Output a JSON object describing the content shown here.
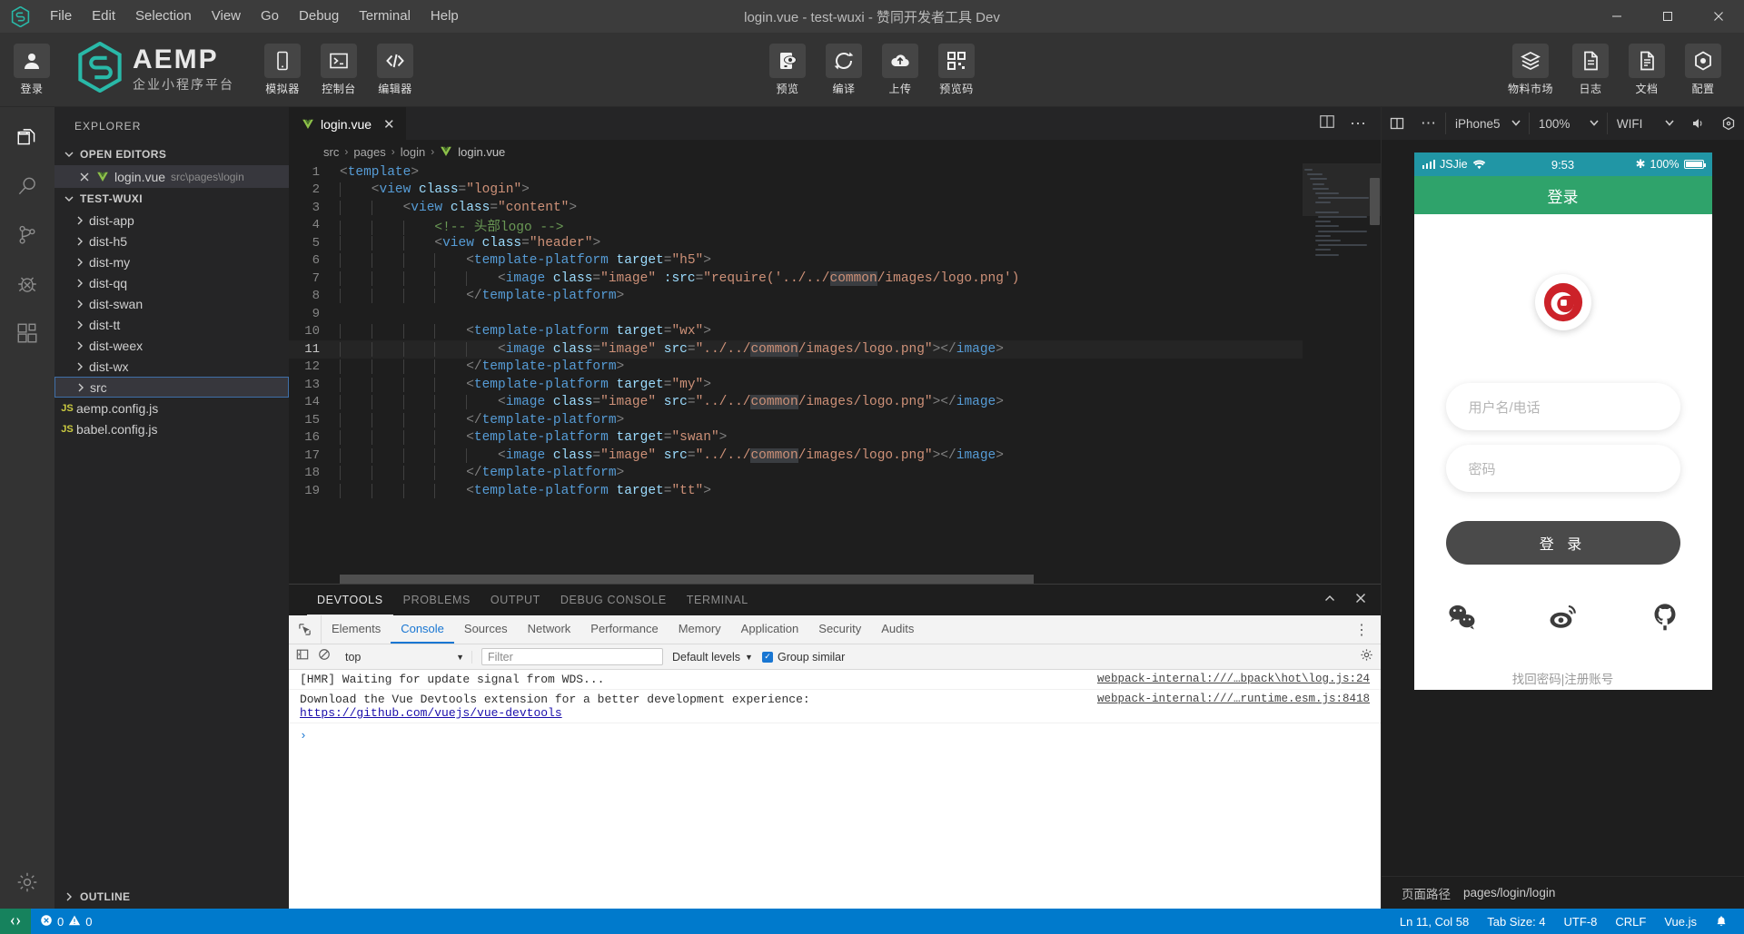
{
  "titlebar": {
    "app_icon": "aemp-hex-logo-icon",
    "menus": [
      "File",
      "Edit",
      "Selection",
      "View",
      "Go",
      "Debug",
      "Terminal",
      "Help"
    ],
    "title": "login.vue - test-wuxi - 赞同开发者工具 Dev",
    "window_buttons": [
      "minimize-icon",
      "maximize-icon",
      "close-icon"
    ]
  },
  "aemp_toolbar": {
    "login": {
      "label": "登录",
      "icon": "user-avatar-icon"
    },
    "brand": {
      "name": "AEMP",
      "sub": "企业小程序平台",
      "icon": "aemp-hex-logo-icon"
    },
    "left_tools": [
      {
        "label": "模拟器",
        "icon": "phone-icon"
      },
      {
        "label": "控制台",
        "icon": "terminal-icon"
      },
      {
        "label": "编辑器",
        "icon": "code-brackets-icon"
      }
    ],
    "center_tools": [
      {
        "label": "预览",
        "icon": "preview-eye-icon"
      },
      {
        "label": "编译",
        "icon": "refresh-circle-icon"
      },
      {
        "label": "上传",
        "icon": "cloud-upload-icon"
      },
      {
        "label": "预览码",
        "icon": "qrcode-icon"
      }
    ],
    "right_tools": [
      {
        "label": "物料市场",
        "icon": "layers-icon"
      },
      {
        "label": "日志",
        "icon": "document-icon"
      },
      {
        "label": "文档",
        "icon": "document-lines-icon"
      },
      {
        "label": "配置",
        "icon": "hex-gear-icon"
      }
    ]
  },
  "activitybar": {
    "items": [
      {
        "name": "explorer",
        "icon": "files-icon",
        "active": true
      },
      {
        "name": "search",
        "icon": "search-icon",
        "active": false
      },
      {
        "name": "source-control",
        "icon": "source-control-branch-icon",
        "active": false
      },
      {
        "name": "debug",
        "icon": "bug-icon",
        "active": false
      },
      {
        "name": "extensions",
        "icon": "extensions-blocks-icon",
        "active": false
      }
    ],
    "bottom": {
      "name": "manage",
      "icon": "gear-icon"
    }
  },
  "sidebar": {
    "title": "EXPLORER",
    "open_editors": {
      "label": "OPEN EDITORS",
      "items": [
        {
          "name": "login.vue",
          "path": "src\\pages\\login",
          "icon": "vue-file-icon",
          "close": "close-icon"
        }
      ]
    },
    "project": {
      "label": "TEST-WUXI",
      "folders": [
        "dist-app",
        "dist-h5",
        "dist-my",
        "dist-qq",
        "dist-swan",
        "dist-tt",
        "dist-weex",
        "dist-wx",
        "src"
      ],
      "selected_folder": "src",
      "files": [
        {
          "name": "aemp.config.js",
          "badge": "JS"
        },
        {
          "name": "babel.config.js",
          "badge": "JS"
        }
      ]
    },
    "outline_label": "OUTLINE"
  },
  "editor": {
    "tab": {
      "name": "login.vue",
      "icon": "vue-file-icon",
      "close": "close-icon"
    },
    "tab_actions": [
      "split-editor-icon",
      "more-actions-icon"
    ],
    "breadcrumb": [
      "src",
      "pages",
      "login",
      "login.vue"
    ],
    "lines": [
      {
        "n": 1,
        "indent": 0,
        "tokens": [
          [
            "t-punct",
            "<"
          ],
          [
            "t-tag",
            "template"
          ],
          [
            "t-punct",
            ">"
          ]
        ]
      },
      {
        "n": 2,
        "indent": 1,
        "tokens": [
          [
            "t-punct",
            "<"
          ],
          [
            "t-tag",
            "view"
          ],
          [
            "plain",
            " "
          ],
          [
            "t-attr",
            "class"
          ],
          [
            "t-punct",
            "="
          ],
          [
            "t-str",
            "\"login\""
          ],
          [
            "t-punct",
            ">"
          ]
        ]
      },
      {
        "n": 3,
        "indent": 2,
        "tokens": [
          [
            "t-punct",
            "<"
          ],
          [
            "t-tag",
            "view"
          ],
          [
            "plain",
            " "
          ],
          [
            "t-attr",
            "class"
          ],
          [
            "t-punct",
            "="
          ],
          [
            "t-str",
            "\"content\""
          ],
          [
            "t-punct",
            ">"
          ]
        ]
      },
      {
        "n": 4,
        "indent": 3,
        "tokens": [
          [
            "t-cmt",
            "<!-- 头部logo -->"
          ]
        ]
      },
      {
        "n": 5,
        "indent": 3,
        "tokens": [
          [
            "t-punct",
            "<"
          ],
          [
            "t-tag",
            "view"
          ],
          [
            "plain",
            " "
          ],
          [
            "t-attr",
            "class"
          ],
          [
            "t-punct",
            "="
          ],
          [
            "t-str",
            "\"header\""
          ],
          [
            "t-punct",
            ">"
          ]
        ]
      },
      {
        "n": 6,
        "indent": 4,
        "tokens": [
          [
            "t-punct",
            "<"
          ],
          [
            "t-tag",
            "template-platform"
          ],
          [
            "plain",
            " "
          ],
          [
            "t-attr",
            "target"
          ],
          [
            "t-punct",
            "="
          ],
          [
            "t-str",
            "\"h5\""
          ],
          [
            "t-punct",
            ">"
          ]
        ]
      },
      {
        "n": 7,
        "indent": 5,
        "tokens": [
          [
            "t-punct",
            "<"
          ],
          [
            "t-tag",
            "image"
          ],
          [
            "plain",
            " "
          ],
          [
            "t-attr",
            "class"
          ],
          [
            "t-punct",
            "="
          ],
          [
            "t-str",
            "\"image\""
          ],
          [
            "plain",
            " "
          ],
          [
            "t-attr",
            ":src"
          ],
          [
            "t-punct",
            "="
          ],
          [
            "t-str",
            "\"require('../../"
          ],
          [
            "t-str t-hl",
            "common"
          ],
          [
            "t-str",
            "/images/logo.png')"
          ]
        ]
      },
      {
        "n": 8,
        "indent": 4,
        "tokens": [
          [
            "t-punct",
            "</"
          ],
          [
            "t-tag",
            "template-platform"
          ],
          [
            "t-punct",
            ">"
          ]
        ]
      },
      {
        "n": 9,
        "indent": 0,
        "tokens": []
      },
      {
        "n": 10,
        "indent": 4,
        "tokens": [
          [
            "t-punct",
            "<"
          ],
          [
            "t-tag",
            "template-platform"
          ],
          [
            "plain",
            " "
          ],
          [
            "t-attr",
            "target"
          ],
          [
            "t-punct",
            "="
          ],
          [
            "t-str",
            "\"wx\""
          ],
          [
            "t-punct",
            ">"
          ]
        ]
      },
      {
        "n": 11,
        "indent": 5,
        "current": true,
        "tokens": [
          [
            "t-punct",
            "<"
          ],
          [
            "t-tag",
            "image"
          ],
          [
            "plain",
            " "
          ],
          [
            "t-attr",
            "class"
          ],
          [
            "t-punct",
            "="
          ],
          [
            "t-str",
            "\"image\""
          ],
          [
            "plain",
            " "
          ],
          [
            "t-attr",
            "src"
          ],
          [
            "t-punct",
            "="
          ],
          [
            "t-str",
            "\"../../"
          ],
          [
            "t-str t-hl",
            "common"
          ],
          [
            "t-str",
            "/images/logo.png\""
          ],
          [
            "t-punct",
            "></"
          ],
          [
            "t-tag",
            "image"
          ],
          [
            "t-punct",
            ">"
          ]
        ]
      },
      {
        "n": 12,
        "indent": 4,
        "tokens": [
          [
            "t-punct",
            "</"
          ],
          [
            "t-tag",
            "template-platform"
          ],
          [
            "t-punct",
            ">"
          ]
        ]
      },
      {
        "n": 13,
        "indent": 4,
        "tokens": [
          [
            "t-punct",
            "<"
          ],
          [
            "t-tag",
            "template-platform"
          ],
          [
            "plain",
            " "
          ],
          [
            "t-attr",
            "target"
          ],
          [
            "t-punct",
            "="
          ],
          [
            "t-str",
            "\"my\""
          ],
          [
            "t-punct",
            ">"
          ]
        ]
      },
      {
        "n": 14,
        "indent": 5,
        "tokens": [
          [
            "t-punct",
            "<"
          ],
          [
            "t-tag",
            "image"
          ],
          [
            "plain",
            " "
          ],
          [
            "t-attr",
            "class"
          ],
          [
            "t-punct",
            "="
          ],
          [
            "t-str",
            "\"image\""
          ],
          [
            "plain",
            " "
          ],
          [
            "t-attr",
            "src"
          ],
          [
            "t-punct",
            "="
          ],
          [
            "t-str",
            "\"../../"
          ],
          [
            "t-str t-hl",
            "common"
          ],
          [
            "t-str",
            "/images/logo.png\""
          ],
          [
            "t-punct",
            "></"
          ],
          [
            "t-tag",
            "image"
          ],
          [
            "t-punct",
            ">"
          ]
        ]
      },
      {
        "n": 15,
        "indent": 4,
        "tokens": [
          [
            "t-punct",
            "</"
          ],
          [
            "t-tag",
            "template-platform"
          ],
          [
            "t-punct",
            ">"
          ]
        ]
      },
      {
        "n": 16,
        "indent": 4,
        "tokens": [
          [
            "t-punct",
            "<"
          ],
          [
            "t-tag",
            "template-platform"
          ],
          [
            "plain",
            " "
          ],
          [
            "t-attr",
            "target"
          ],
          [
            "t-punct",
            "="
          ],
          [
            "t-str",
            "\"swan\""
          ],
          [
            "t-punct",
            ">"
          ]
        ]
      },
      {
        "n": 17,
        "indent": 5,
        "tokens": [
          [
            "t-punct",
            "<"
          ],
          [
            "t-tag",
            "image"
          ],
          [
            "plain",
            " "
          ],
          [
            "t-attr",
            "class"
          ],
          [
            "t-punct",
            "="
          ],
          [
            "t-str",
            "\"image\""
          ],
          [
            "plain",
            " "
          ],
          [
            "t-attr",
            "src"
          ],
          [
            "t-punct",
            "="
          ],
          [
            "t-str",
            "\"../../"
          ],
          [
            "t-str t-hl",
            "common"
          ],
          [
            "t-str",
            "/images/logo.png\""
          ],
          [
            "t-punct",
            "></"
          ],
          [
            "t-tag",
            "image"
          ],
          [
            "t-punct",
            ">"
          ]
        ]
      },
      {
        "n": 18,
        "indent": 4,
        "tokens": [
          [
            "t-punct",
            "</"
          ],
          [
            "t-tag",
            "template-platform"
          ],
          [
            "t-punct",
            ">"
          ]
        ]
      },
      {
        "n": 19,
        "indent": 4,
        "tokens": [
          [
            "t-punct",
            "<"
          ],
          [
            "t-tag",
            "template-platform"
          ],
          [
            "plain",
            " "
          ],
          [
            "t-attr",
            "target"
          ],
          [
            "t-punct",
            "="
          ],
          [
            "t-str",
            "\"tt\""
          ],
          [
            "t-punct",
            ">"
          ]
        ]
      }
    ]
  },
  "panel": {
    "tabs": [
      "DEVTOOLS",
      "PROBLEMS",
      "OUTPUT",
      "DEBUG CONSOLE",
      "TERMINAL"
    ],
    "active_tab": "DEVTOOLS",
    "actions": [
      "chevron-up-icon",
      "close-icon"
    ],
    "devtools": {
      "inspect_icon": "inspect-cursor-icon",
      "tabs": [
        "Elements",
        "Console",
        "Sources",
        "Network",
        "Performance",
        "Memory",
        "Application",
        "Security",
        "Audits"
      ],
      "active_tab": "Console",
      "more_icon": "kebab-menu-icon",
      "filterbar": {
        "sidebar_icon": "console-sidebar-icon",
        "clear_icon": "clear-console-icon",
        "context": "top",
        "filter_placeholder": "Filter",
        "levels": "Default levels",
        "group_similar": "Group similar",
        "group_similar_checked": true,
        "settings_icon": "gear-icon"
      },
      "logs": [
        {
          "text": "[HMR] Waiting for update signal from WDS...",
          "source": "webpack-internal:///…bpack\\hot\\log.js:24",
          "link": ""
        },
        {
          "text": "Download the Vue Devtools extension for a better development experience:",
          "source": "webpack-internal:///…runtime.esm.js:8418",
          "link": "https://github.com/vuejs/vue-devtools"
        }
      ],
      "prompt": "›"
    }
  },
  "simulator": {
    "controls": {
      "layout_icon": "split-layout-icon",
      "more_icon": "more-dots-icon",
      "device": "iPhone5",
      "zoom": "100%",
      "network": "WIFI",
      "volume_icon": "volume-icon",
      "rotate_icon": "hex-rotate-icon"
    },
    "phone": {
      "status": {
        "carrier": "JSJie",
        "signal_icon": "signal-bars-icon",
        "wifi_icon": "wifi-icon",
        "time": "9:53",
        "bluetooth_icon": "bluetooth-icon",
        "battery": "100%",
        "battery_icon": "battery-full-icon"
      },
      "navbar_title": "登录",
      "logo_icon": "zantong-red-logo-icon",
      "username_placeholder": "用户名/电话",
      "password_placeholder": "密码",
      "login_button": "登 录",
      "socials": [
        {
          "name": "wechat",
          "icon": "wechat-icon"
        },
        {
          "name": "weibo",
          "icon": "weibo-icon"
        },
        {
          "name": "github",
          "icon": "github-icon"
        }
      ],
      "footer_links": "找回密码|注册账号"
    },
    "footer": {
      "label": "页面路径",
      "value": "pages/login/login"
    }
  },
  "statusbar": {
    "remote_icon": "remote-window-icon",
    "errors_icon": "error-circle-icon",
    "errors": "0",
    "warnings_icon": "warning-triangle-icon",
    "warnings": "0",
    "cursor": "Ln 11, Col 58",
    "tab_size": "Tab Size: 4",
    "encoding": "UTF-8",
    "eol": "CRLF",
    "language": "Vue.js",
    "bell_icon": "bell-icon"
  }
}
